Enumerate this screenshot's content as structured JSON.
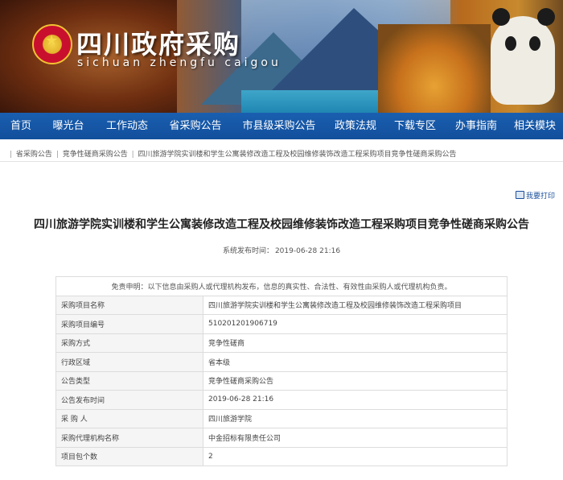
{
  "header": {
    "title": "四川政府采购",
    "subtitle": "sichuan zhengfu caigou"
  },
  "nav": {
    "items": [
      "首页",
      "曝光台",
      "工作动态",
      "省采购公告",
      "市县级采购公告",
      "政策法规",
      "下载专区",
      "办事指南",
      "相关模块"
    ]
  },
  "breadcrumb": {
    "items": [
      "省采购公告",
      "竞争性磋商采购公告",
      "四川旅游学院实训楼和学生公寓装修改造工程及校园维修装饰改造工程采购项目竞争性磋商采购公告"
    ]
  },
  "print_label": "我要打印",
  "article": {
    "title": "四川旅游学院实训楼和学生公寓装修改造工程及校园维修装饰改造工程采购项目竞争性磋商采购公告",
    "publish_label": "系统发布时间：",
    "publish_time": "2019-06-28 21:16"
  },
  "table": {
    "disclaimer": "免责申明：以下信息由采购人或代理机构发布，信息的真实性、合法性、有效性由采购人或代理机构负责。",
    "rows": [
      {
        "key": "采购项目名称",
        "value": "四川旅游学院实训楼和学生公寓装修改造工程及校园维修装饰改造工程采购项目"
      },
      {
        "key": "采购项目编号",
        "value": "510201201906719"
      },
      {
        "key": "采购方式",
        "value": "竞争性磋商"
      },
      {
        "key": "行政区域",
        "value": "省本级"
      },
      {
        "key": "公告类型",
        "value": "竞争性磋商采购公告"
      },
      {
        "key": "公告发布时间",
        "value": "2019-06-28 21:16"
      },
      {
        "key": "采 购 人",
        "value": "四川旅游学院"
      },
      {
        "key": "采购代理机构名称",
        "value": "中金招标有限责任公司"
      },
      {
        "key": "项目包个数",
        "value": "2"
      }
    ]
  }
}
